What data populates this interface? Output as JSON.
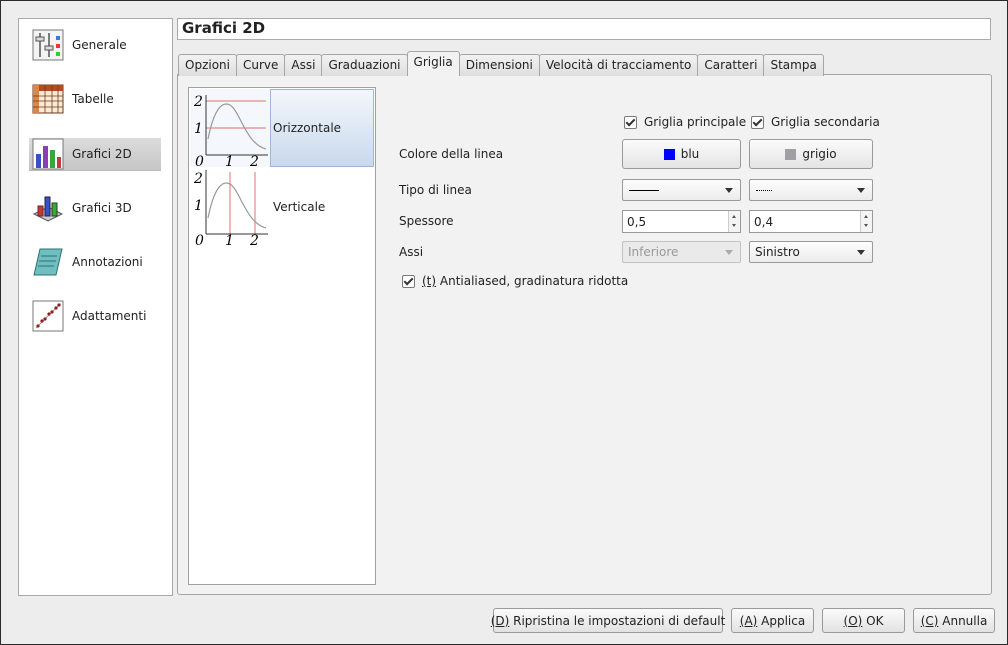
{
  "sidebar": {
    "items": [
      {
        "label": "Generale",
        "icon": "settings-sliders-icon"
      },
      {
        "label": "Tabelle",
        "icon": "table-icon"
      },
      {
        "label": "Grafici 2D",
        "icon": "bar-chart-icon"
      },
      {
        "label": "Grafici 3D",
        "icon": "3d-chart-icon"
      },
      {
        "label": "Annotazioni",
        "icon": "annotation-icon"
      },
      {
        "label": "Adattamenti",
        "icon": "fit-curve-icon"
      }
    ],
    "active": "Grafici 2D"
  },
  "title": "Grafici 2D",
  "tabs": [
    "Opzioni",
    "Curve",
    "Assi",
    "Graduazioni",
    "Griglia",
    "Dimensioni",
    "Velocità di tracciamento",
    "Caratteri",
    "Stampa"
  ],
  "active_tab": "Griglia",
  "grid_list": {
    "items": [
      {
        "label": "Orizzontale",
        "preview_ticks_y": [
          "2",
          "1"
        ],
        "preview_ticks_x": [
          "0",
          "1",
          "2"
        ]
      },
      {
        "label": "Verticale",
        "preview_ticks_y": [
          "2",
          "1"
        ],
        "preview_ticks_x": [
          "0",
          "1",
          "2"
        ]
      }
    ],
    "selected": "Orizzontale"
  },
  "form": {
    "major_grid_label": "Griglia principale",
    "minor_grid_label": "Griglia secondaria",
    "major_grid_checked": true,
    "minor_grid_checked": true,
    "line_color_label": "Colore della linea",
    "major_color": {
      "name": "blu",
      "hex": "#0000ff"
    },
    "minor_color": {
      "name": "grigio",
      "hex": "#a0a0a4"
    },
    "line_type_label": "Tipo di linea",
    "major_line_type": "solid",
    "minor_line_type": "dotted",
    "thickness_label": "Spessore",
    "major_thickness": "0,5",
    "minor_thickness": "0,4",
    "axes_label": "Assi",
    "major_axis": "Inferiore",
    "minor_axis": "Sinistro",
    "antialias_prefix": "(t)",
    "antialias_label": " Antialiased, gradinatura ridotta",
    "antialias_checked": true
  },
  "buttons": {
    "restore_prefix": "(D)",
    "restore": " Ripristina le impostazioni di default",
    "apply_prefix": "(A)",
    "apply": " Applica",
    "ok_prefix": "(O)",
    "ok": " OK",
    "cancel_prefix": "(C)",
    "cancel": " Annulla"
  }
}
